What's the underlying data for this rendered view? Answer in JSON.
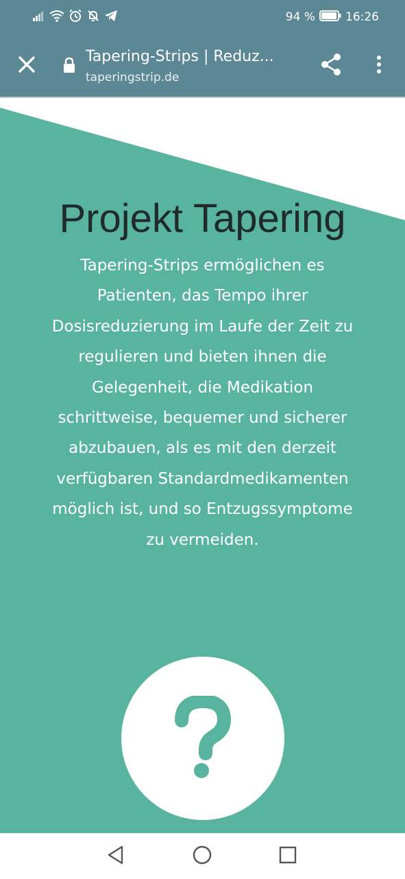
{
  "status_bar": {
    "battery_percent": "94 %",
    "time": "16:26",
    "icons": [
      "signal-icon",
      "wifi-icon",
      "alarm-icon",
      "notifications-off-icon",
      "telegram-icon",
      "battery-icon"
    ]
  },
  "toolbar": {
    "title": "Tapering-Strips | Reduz...",
    "url": "taperingstrip.de",
    "icons": [
      "close-icon",
      "lock-icon",
      "share-icon",
      "more-vert-icon"
    ]
  },
  "hero": {
    "title": "Projekt Tapering",
    "lines": [
      "Tapering-Strips ermöglichen es",
      "Patienten, das Tempo ihrer",
      "Dosisreduzierung im Laufe der Zeit zu",
      "regulieren und bieten ihnen die",
      "Gelegenheit, die Medikation",
      "schrittweise, bequemer und sicherer",
      "abzubauen, als es mit den derzeit",
      "verfügbaren Standardmedikamenten",
      "möglich ist, und so Entzugssymptome",
      "zu vermeiden."
    ],
    "icon": "question-icon"
  },
  "nav_bar": {
    "icons": [
      "back-triangle-icon",
      "home-circle-icon",
      "recents-square-icon"
    ]
  },
  "colors": {
    "toolbar": "#5c8896",
    "teal": "#58b39f",
    "title_text": "#1f2a2a",
    "body_text": "#ffffff"
  }
}
